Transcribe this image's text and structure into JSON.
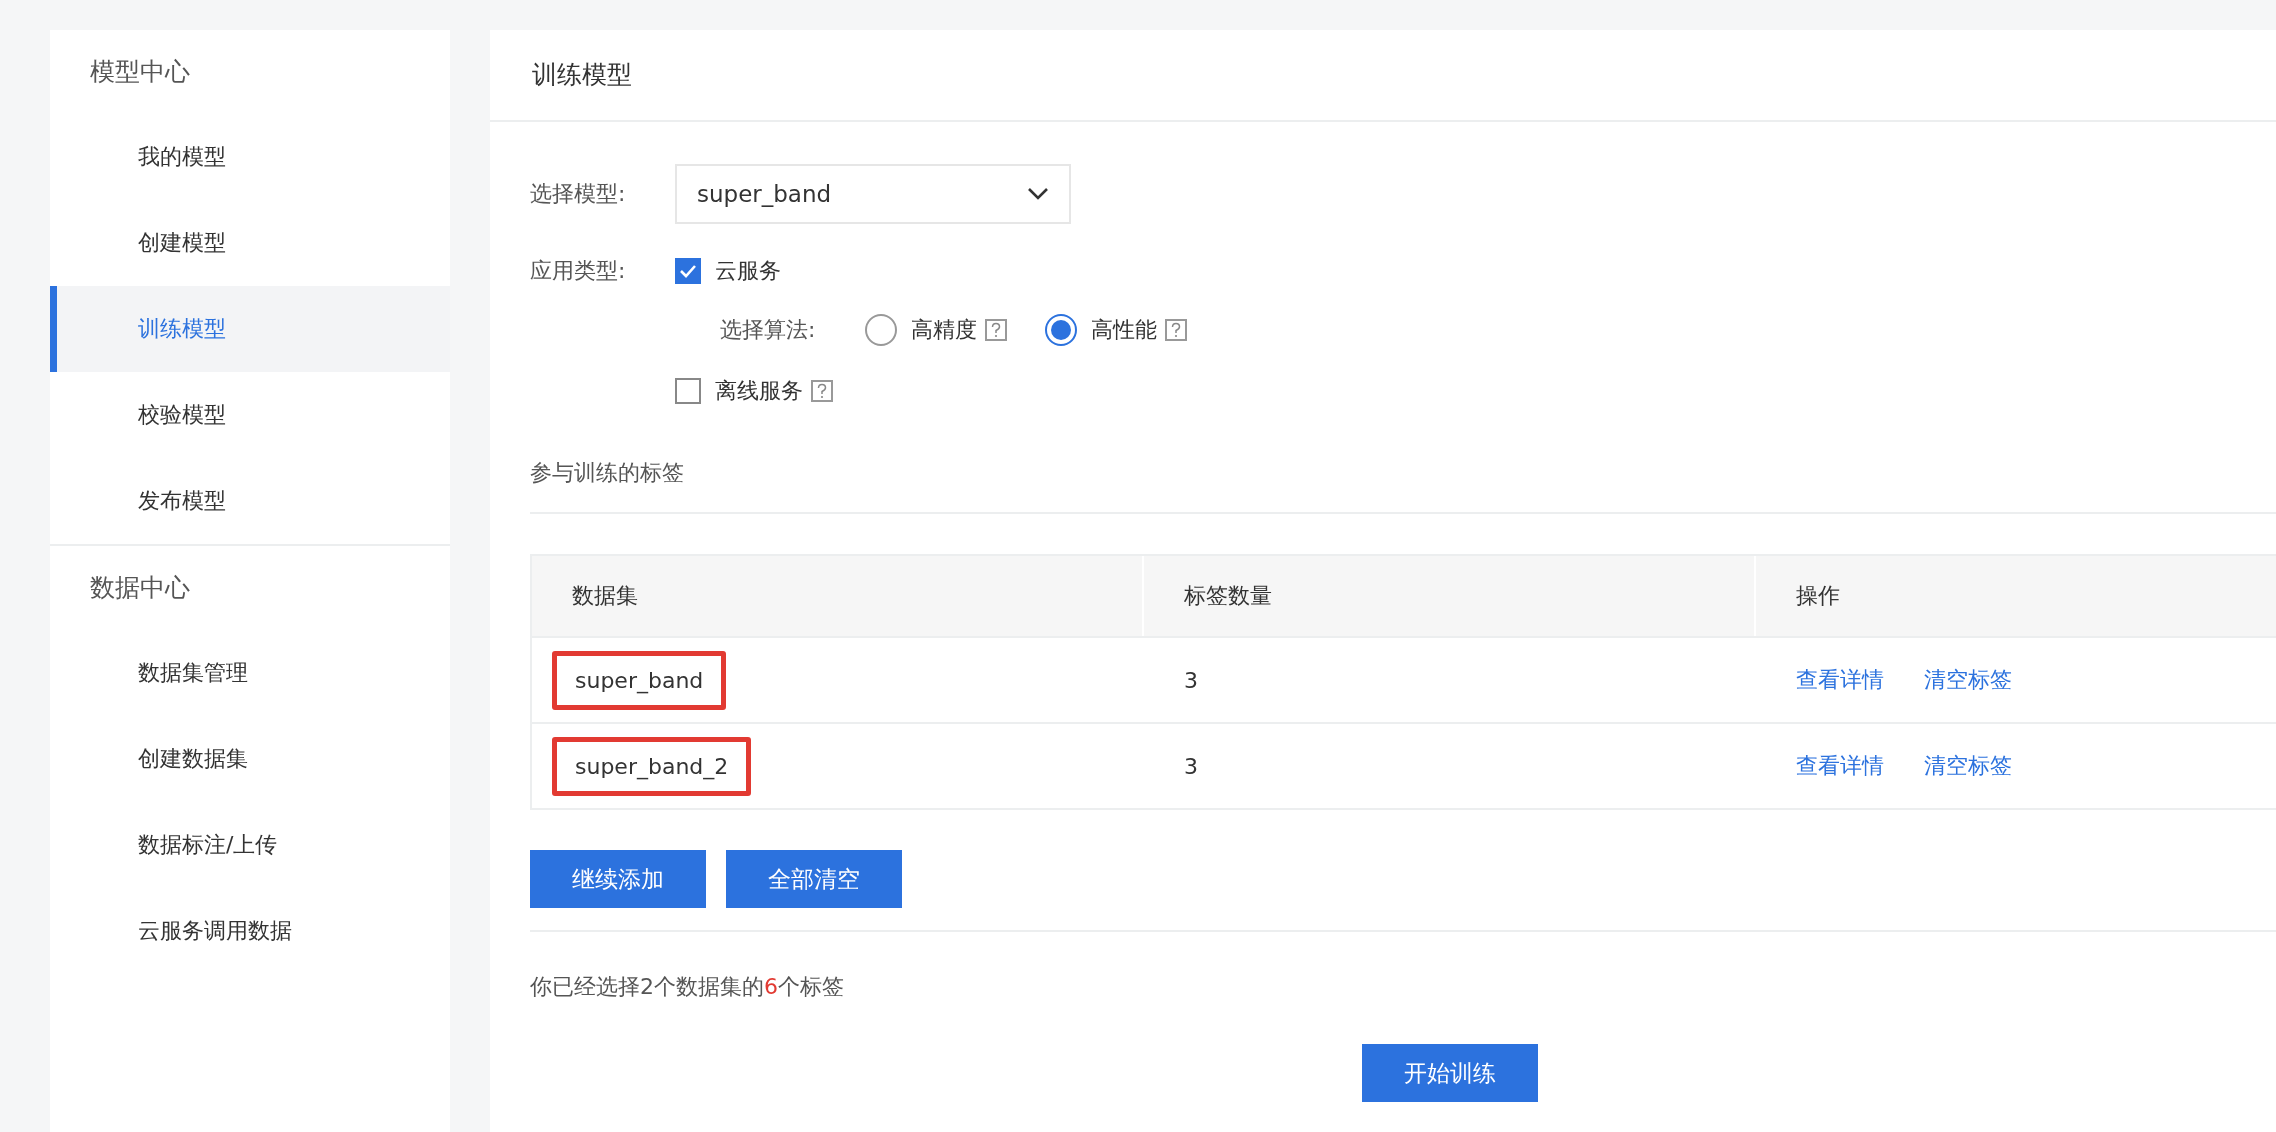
{
  "sidebar": {
    "groups": [
      {
        "title": "模型中心",
        "items": [
          {
            "label": "我的模型",
            "selected": false
          },
          {
            "label": "创建模型",
            "selected": false
          },
          {
            "label": "训练模型",
            "selected": true
          },
          {
            "label": "校验模型",
            "selected": false
          },
          {
            "label": "发布模型",
            "selected": false
          }
        ]
      },
      {
        "title": "数据中心",
        "items": [
          {
            "label": "数据集管理",
            "selected": false
          },
          {
            "label": "创建数据集",
            "selected": false
          },
          {
            "label": "数据标注/上传",
            "selected": false
          },
          {
            "label": "云服务调用数据",
            "selected": false
          }
        ]
      }
    ]
  },
  "page_title": "训练模型",
  "model_select": {
    "label": "选择模型:",
    "value": "super_band"
  },
  "app_type": {
    "label": "应用类型:",
    "cloud": {
      "label": "云服务",
      "checked": true
    },
    "algorithm": {
      "label": "选择算法:",
      "options": [
        {
          "label": "高精度",
          "selected": false
        },
        {
          "label": "高性能",
          "selected": true
        }
      ]
    },
    "offline": {
      "label": "离线服务",
      "checked": false
    }
  },
  "section_title": "参与训练的标签",
  "table": {
    "columns": [
      "数据集",
      "标签数量",
      "操作"
    ],
    "rows": [
      {
        "dataset": "super_band",
        "count": "3",
        "highlighted": true,
        "actions": [
          "查看详情",
          "清空标签"
        ]
      },
      {
        "dataset": "super_band_2",
        "count": "3",
        "highlighted": true,
        "actions": [
          "查看详情",
          "清空标签"
        ]
      }
    ]
  },
  "buttons": [
    "继续添加",
    "全部清空"
  ],
  "summary": {
    "prefix": "你已经选择2个数据集的",
    "count": "6",
    "suffix": "个标签"
  },
  "start_button": "开始训练"
}
